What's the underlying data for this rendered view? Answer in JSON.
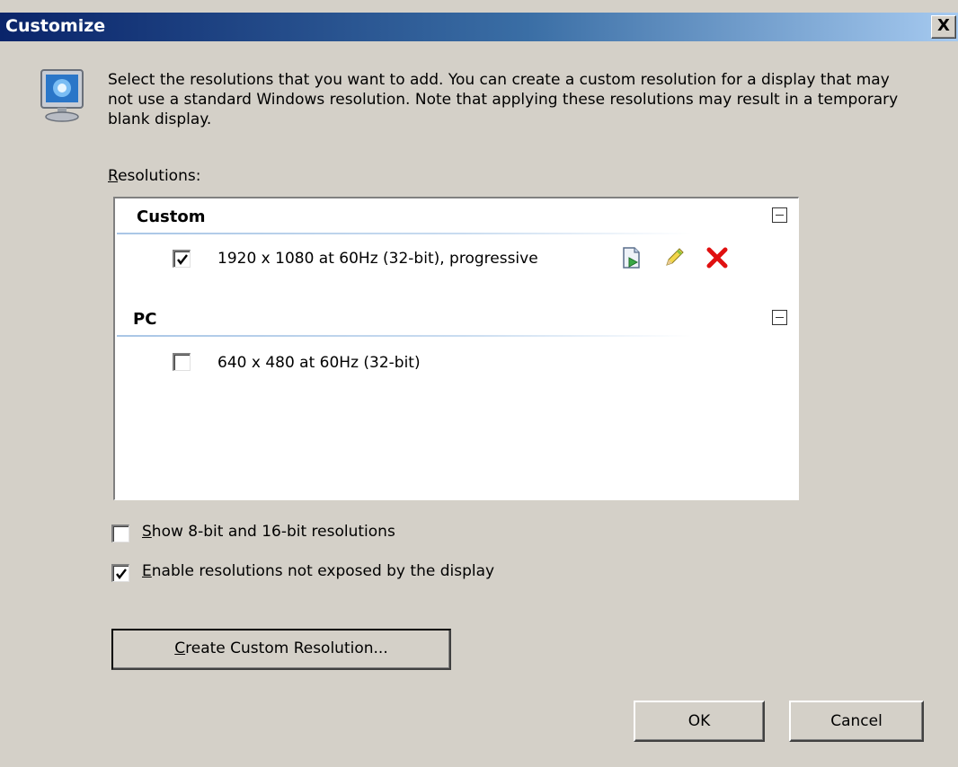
{
  "window": {
    "title": "Customize",
    "close_label": "X"
  },
  "intro_text": "Select the resolutions that you want to add. You can create a custom resolution for a display that may not use a standard Windows resolution. Note that applying these resolutions may result in a temporary blank display.",
  "resolutions_label": "Resolutions:",
  "groups": [
    {
      "title": "Custom",
      "items": [
        {
          "label": "1920 x 1080 at 60Hz (32-bit), progressive",
          "checked": true,
          "icons": [
            "test-icon",
            "edit-pencil-icon",
            "delete-x-icon"
          ]
        }
      ]
    },
    {
      "title": "PC",
      "items": [
        {
          "label": "640 x 480 at 60Hz (32-bit)",
          "checked": false
        }
      ]
    }
  ],
  "options": {
    "show_8_16": {
      "label": "Show 8-bit and 16-bit resolutions",
      "checked": false
    },
    "enable_unexposed": {
      "label": "Enable resolutions not exposed by the display",
      "checked": true
    }
  },
  "buttons": {
    "create": "Create Custom Resolution...",
    "ok": "OK",
    "cancel": "Cancel"
  },
  "colors": {
    "dialog_bg": "#d4d0c8",
    "titlebar_start": "#0a246a",
    "titlebar_end": "#a6caf0",
    "delete_red": "#e01010"
  }
}
